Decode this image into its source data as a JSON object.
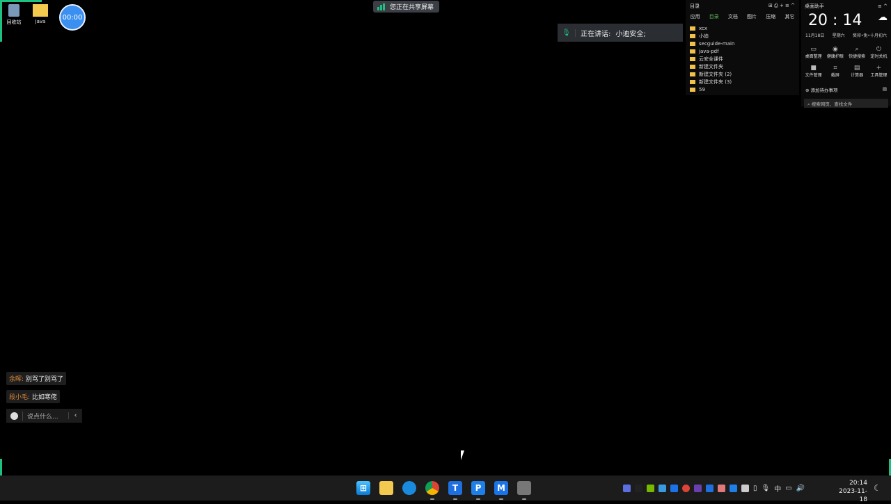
{
  "desktop": {
    "icons": [
      {
        "label": "回收站"
      },
      {
        "label": "java"
      }
    ],
    "timer": "00:00"
  },
  "share_banner": "您正在共享屏幕",
  "speaking": {
    "label": "正在讲话:",
    "name": "小迪安全;"
  },
  "directory": {
    "title": "目录",
    "tabs": [
      "应用",
      "目录",
      "文档",
      "图片",
      "压缩",
      "其它"
    ],
    "active_tab": "目录",
    "folders": [
      "xcx",
      "小迪",
      "secguide-main",
      "java-pdf",
      "云安全课件",
      "新建文件夹",
      "新建文件夹 (2)",
      "新建文件夹 (3)",
      "59"
    ]
  },
  "assistant": {
    "title": "桌面助手",
    "time": "20 : 14",
    "date": "11月18日",
    "weekday": "星期六",
    "lunar": "癸卯•兔•十月初六",
    "tools": [
      {
        "icon": "monitor-icon",
        "label": "桌面整理"
      },
      {
        "icon": "eye-icon",
        "label": "健康护眼"
      },
      {
        "icon": "search-icon",
        "label": "快捷搜索"
      },
      {
        "icon": "power-icon",
        "label": "定时关机"
      },
      {
        "icon": "folder-icon",
        "label": "文件管理"
      },
      {
        "icon": "crop-icon",
        "label": "截屏"
      },
      {
        "icon": "calculator-icon",
        "label": "计算器"
      },
      {
        "icon": "plus-icon",
        "label": "工具管理"
      }
    ],
    "todo": "添加待办事项",
    "search_placeholder": "搜索网页、查找文件"
  },
  "chat": {
    "messages": [
      {
        "user": "余晖:",
        "text": "别骂了别骂了"
      },
      {
        "user": "段小毛:",
        "text": "比如寒佬"
      }
    ],
    "input_placeholder": "说点什么..."
  },
  "taskbar": {
    "apps": [
      "start",
      "file-explorer",
      "edge",
      "chrome",
      "app-t",
      "app-p",
      "app-m",
      "app-camera"
    ],
    "ime": "中",
    "time": "20:14",
    "date": "2023-11-18"
  },
  "colors": {
    "accent": "#1fbf80",
    "taskbar": "#1c1c1c"
  }
}
